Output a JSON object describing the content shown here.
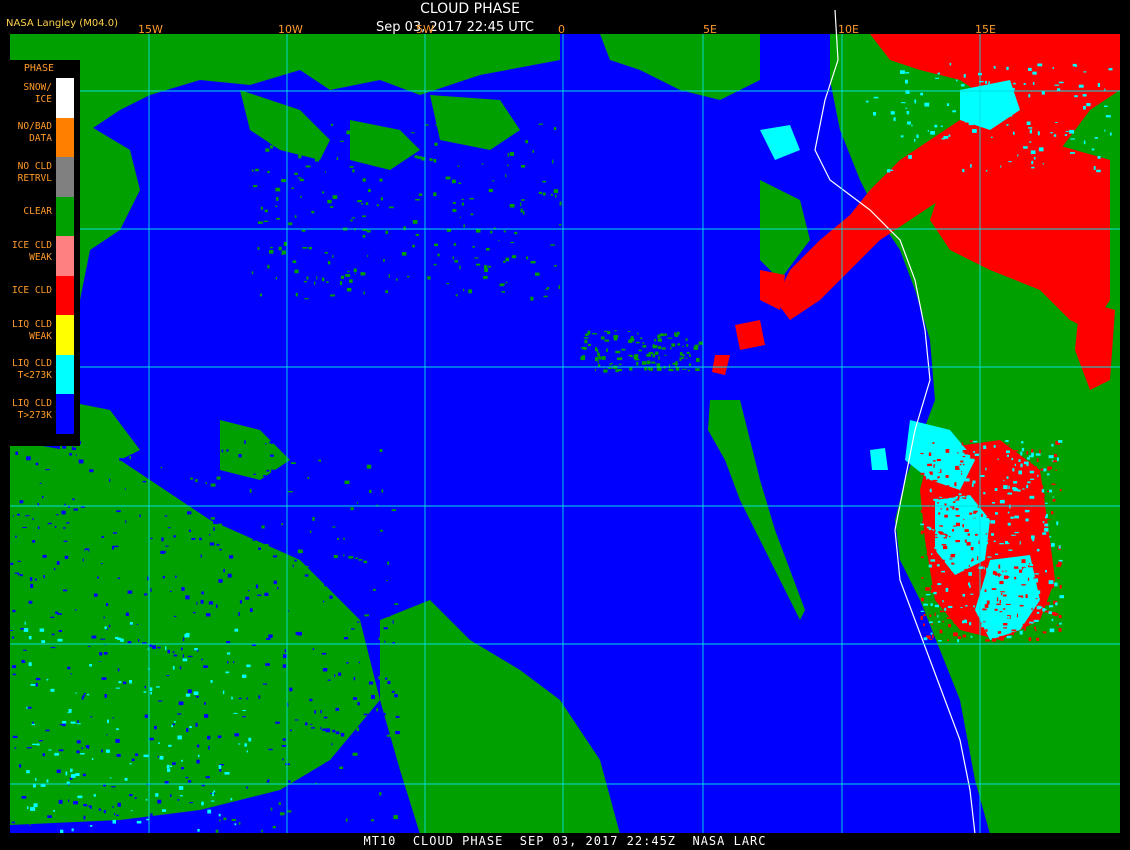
{
  "header": {
    "title": "CLOUD PHASE",
    "subtitle": "Sep 03, 2017 22:45 UTC",
    "credit": "NASA Langley (M04.0)"
  },
  "longitude_labels": [
    "15W",
    "10W",
    "5W",
    "0",
    "5E",
    "10E",
    "15E"
  ],
  "legend": {
    "heading": "PHASE",
    "items": [
      {
        "label": "SNOW/\nICE",
        "color": "#ffffff"
      },
      {
        "label": "NO/BAD\nDATA",
        "color": "#ff8000"
      },
      {
        "label": "NO CLD\nRETRVL",
        "color": "#808080"
      },
      {
        "label": "CLEAR",
        "color": "#00a000"
      },
      {
        "label": "ICE CLD\nWEAK",
        "color": "#ff8080"
      },
      {
        "label": "ICE CLD",
        "color": "#ff0000"
      },
      {
        "label": "LIQ CLD\nWEAK",
        "color": "#ffff00"
      },
      {
        "label": "LIQ CLD\nT<273K",
        "color": "#00ffff"
      },
      {
        "label": "LIQ CLD\nT>273K",
        "color": "#0000ff"
      }
    ]
  },
  "colors": {
    "background": "#000000",
    "ocean_liquid_cloud": "#0000ff",
    "clear": "#00a000",
    "ice_cloud": "#ff0000",
    "liquid_cold": "#00ffff",
    "grid": "#00e0e0",
    "coastline": "#ffffff"
  },
  "footer": "MT10  CLOUD PHASE  SEP 03, 2017 22:45Z  NASA LARC"
}
